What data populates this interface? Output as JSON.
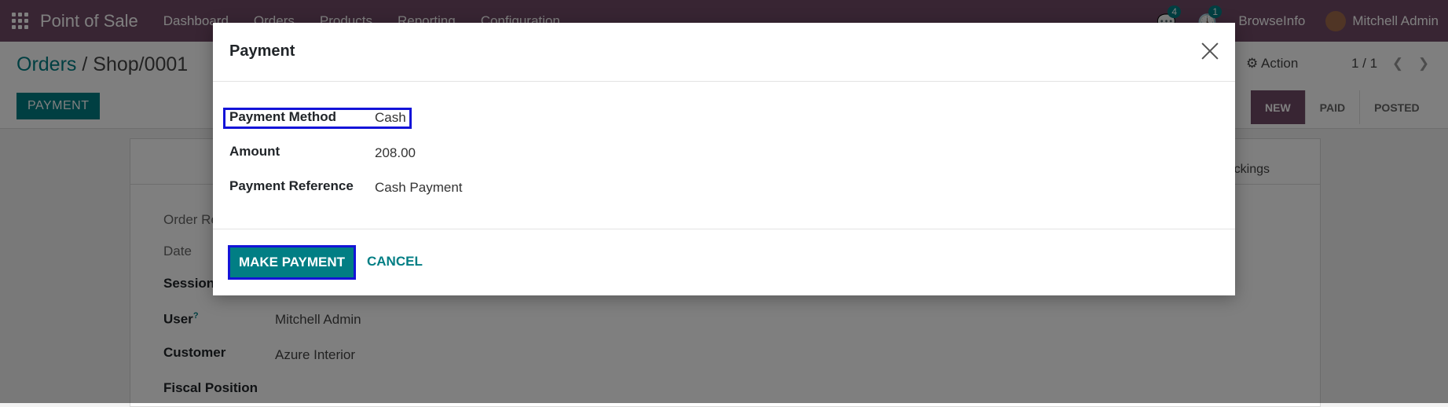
{
  "topbar": {
    "app_name": "Point of Sale",
    "menu": [
      "Dashboard",
      "Orders",
      "Products",
      "Reporting",
      "Configuration"
    ],
    "chat_count": "4",
    "activity_count": "1",
    "company": "BrowseInfo",
    "user": "Mitchell Admin"
  },
  "control": {
    "breadcrumb_parent": "Orders",
    "breadcrumb_sep": "/",
    "breadcrumb_current": "Shop/0001",
    "payment_button": "PAYMENT",
    "action_label": "Action",
    "pager": "1 / 1",
    "stages": [
      "NEW",
      "PAID",
      "POSTED"
    ]
  },
  "sheet": {
    "tab_fragment": "ckings",
    "fields": [
      {
        "label": "Order Re",
        "value": ""
      },
      {
        "label": "Date",
        "value": ""
      },
      {
        "label": "Session",
        "value": ""
      },
      {
        "label": "User",
        "help": "?",
        "value": "Mitchell Admin"
      },
      {
        "label": "Customer",
        "value": "Azure Interior"
      },
      {
        "label": "Fiscal Position",
        "value": ""
      }
    ]
  },
  "modal": {
    "title": "Payment",
    "payment_method_label": "Payment Method",
    "payment_method_value": "Cash",
    "amount_label": "Amount",
    "amount_value": "208.00",
    "reference_label": "Payment Reference",
    "reference_value": "Cash Payment",
    "make_payment": "MAKE PAYMENT",
    "cancel": "CANCEL"
  },
  "colors": {
    "brand": "#714b67",
    "accent": "#017e84",
    "highlight": "#1414d8"
  }
}
